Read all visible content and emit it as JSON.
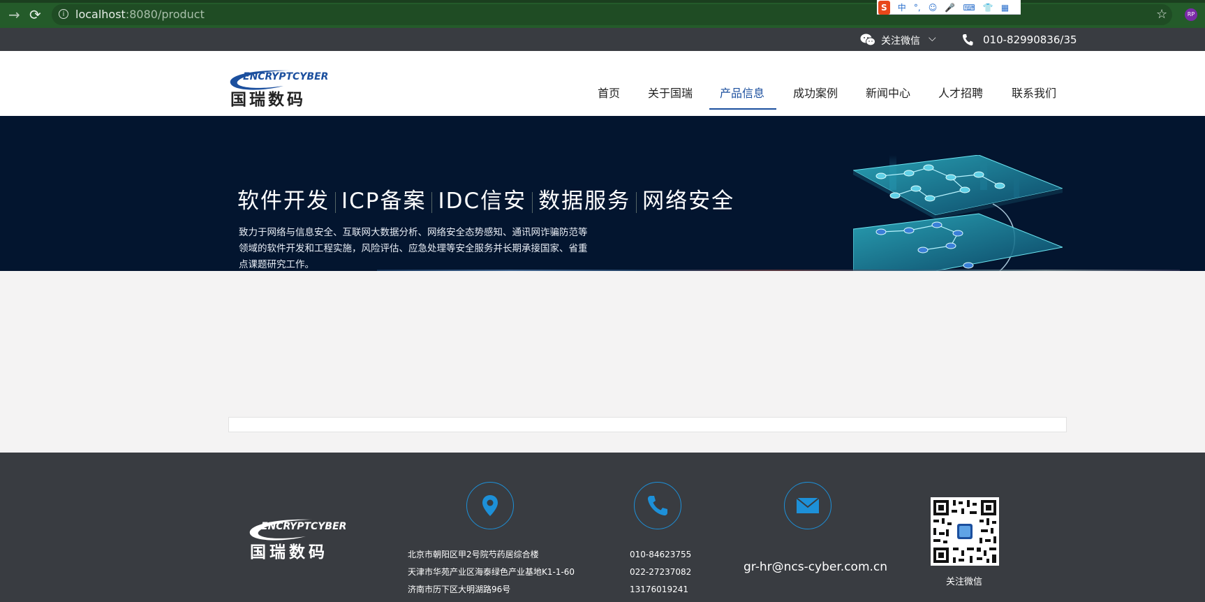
{
  "browser": {
    "url_host": "localhost",
    "url_path": ":8080/product",
    "ime_items": [
      "中",
      "°,",
      "☺",
      "🎤",
      "⌨",
      "👕",
      "▦"
    ],
    "ime_logo": "S",
    "extension_badge": "RP"
  },
  "topbar": {
    "follow_wechat": "关注微信",
    "phone": "010-82990836/35"
  },
  "header": {
    "logo_text_en": "ENCRYPTCYBER",
    "logo_text_cn": "国瑞数码",
    "menu": [
      {
        "label": "首页"
      },
      {
        "label": "关于国瑞"
      },
      {
        "label": "产品信息",
        "active": true
      },
      {
        "label": "成功案例"
      },
      {
        "label": "新闻中心"
      },
      {
        "label": "人才招聘"
      },
      {
        "label": "联系我们"
      }
    ]
  },
  "banner": {
    "headline_parts": [
      "软件开发",
      "ICP备案",
      "IDC信安",
      "数据服务",
      "网络安全"
    ],
    "description": "致力于网络与信息安全、互联网大数据分析、网络安全态势感知、通讯网诈骗防范等领域的软件开发和工程实施，风险评估、应急处理等安全服务并长期承接国家、省重点课题研究工作。"
  },
  "footer": {
    "logo_text_en": "ENCRYPTCYBER",
    "logo_text_cn": "国瑞数码",
    "addresses": [
      "北京市朝阳区甲2号院芍药居综合楼",
      "天津市华苑产业区海泰绿色产业基地K1-1-60",
      "济南市历下区大明湖路96号"
    ],
    "phones": [
      "010-84623755",
      "022-27237082",
      "13176019241"
    ],
    "email": "gr-hr@ncs-cyber.com.cn",
    "qr_label": "关注微信"
  },
  "colors": {
    "accent": "#1b4f9e",
    "banner_bg": "#03152f",
    "footer_bg": "#393c41",
    "icon_blue": "#1d90d8"
  }
}
